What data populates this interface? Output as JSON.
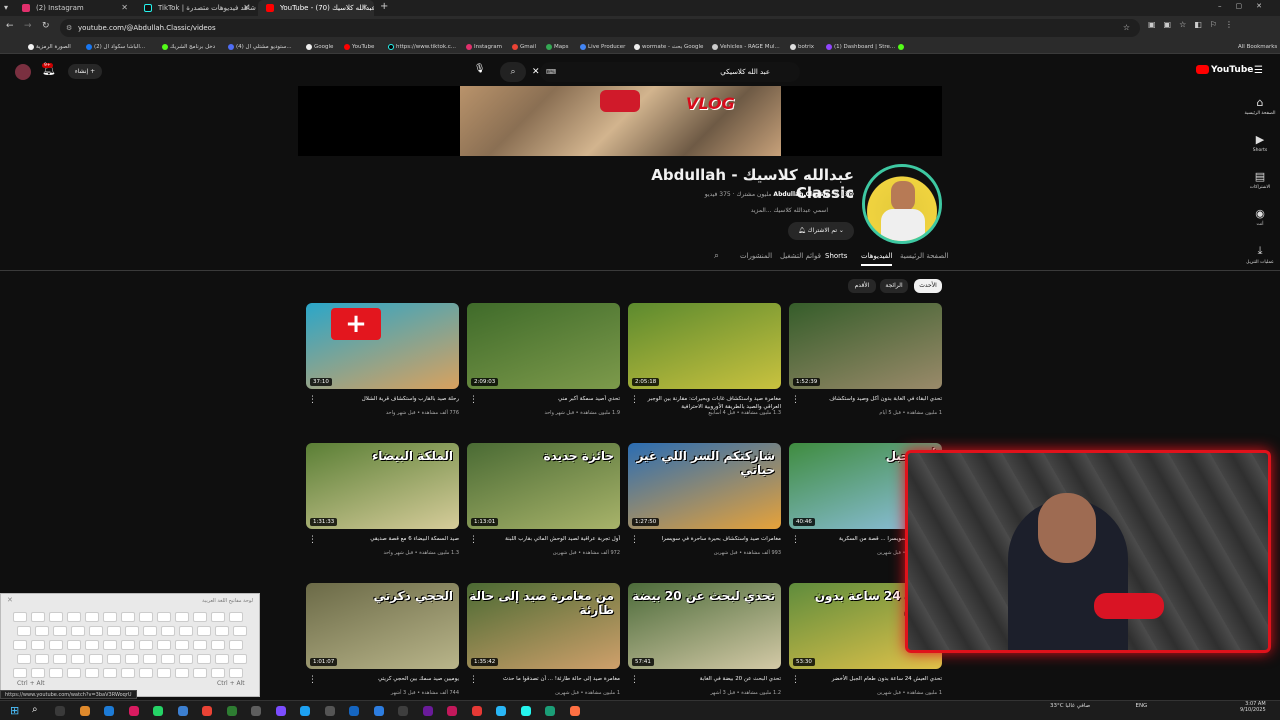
{
  "browser": {
    "tabs": [
      {
        "label": "(2) Instagram",
        "color": "#e1306c"
      },
      {
        "label": "TikTok | شاهد فيديوهات متصدرة",
        "color": "#000000"
      },
      {
        "label": "YouTube - عبدالله كلاسيك (70)",
        "color": "#ff0000"
      }
    ],
    "url": "youtube.com/@Abdullah.Classic/videos",
    "bookmarks": [
      "الصورة الرمزية",
      "(2) الباشا سكواد ال...",
      "دخل برنامج الشريك",
      "(4) ستوديو مشتلي ال...",
      "Google",
      "YouTube",
      "https://www.tiktok.c...",
      "Instagram",
      "Gmail",
      "Maps",
      "Live Producer",
      "wormate - بحث Google",
      "Vehicles - RAGE Mul...",
      "botrix",
      "(1) Dashboard | Stre..."
    ],
    "all_bookmarks": "All Bookmarks"
  },
  "youtube": {
    "logo": "YouTube",
    "create_label": "إنشاء",
    "notif_count": "9+",
    "search_value": "عبد الله كلاسيكي",
    "banner_text": "VLOG"
  },
  "channel": {
    "name": "عبدالله كلاسيك - Abdullah Classic",
    "handle": "@Abdullah.Classic",
    "subs": "2.13 مليون مشترك",
    "videos": "375 فيديو",
    "desc": "اسمي عبدالله كلاسيك ...المزيد",
    "subscribed_label": "تم الاشتراك",
    "tabs": [
      "الصفحة الرئيسية",
      "الفيديوهات",
      "Shorts",
      "قوائم التشغيل",
      "المنشورات"
    ],
    "chips": [
      "الأحدث",
      "الرائجة",
      "الأقدم"
    ]
  },
  "videos": [
    {
      "title": "رحلة صيد بالقارب واستكشاف قرية الشلال",
      "meta": "776 ألف مشاهدة • قبل شهر واحد",
      "dur": "37:10",
      "thumb_text": "",
      "c1": "#2aa6c9",
      "c2": "#d9a15e"
    },
    {
      "title": "تحدي أصيد سمكة أكبر مني",
      "meta": "1.9 مليون مشاهدة • قبل شهر واحد",
      "dur": "2:09:03",
      "thumb_text": "",
      "c1": "#3f6b2a",
      "c2": "#7d9a4b"
    },
    {
      "title": "مغامرة صيد واستكشاف غابات وبحيرات: مقارنة بين الوجبر العراقي والصيد بالطريقة الأوروبية الاحترافية",
      "meta": "1.3 مليون مشاهدة • قبل 4 أسابيع",
      "dur": "2:05:18",
      "thumb_text": "",
      "c1": "#5c8a2e",
      "c2": "#c9c23f"
    },
    {
      "title": "تحدي البقاء في الغابة بدون أكل وصيد واستكشاف",
      "meta": "1 مليون مشاهدة • قبل 5 أيام",
      "dur": "1:52:39",
      "thumb_text": "",
      "c1": "#355d2a",
      "c2": "#9a8a6a"
    },
    {
      "title": "صيد السمكة البيضاء 6 مع قصة صديقي",
      "meta": "1.3 مليون مشاهدة • قبل شهر واحد",
      "dur": "1:31:33",
      "thumb_text": "الملكة البيضاء",
      "c1": "#5a7f35",
      "c2": "#d6cc9a"
    },
    {
      "title": "أول تجربة عراقية لصيد الوحش المائي بقارب اللبنة",
      "meta": "972 ألف مشاهدة • قبل شهرين",
      "dur": "1:13:01",
      "thumb_text": "جائزة جديدة",
      "c1": "#4a6b34",
      "c2": "#a8b36a"
    },
    {
      "title": "مغامرات صيد واستكشاف بحيرة ساحرة في سويسرا",
      "meta": "993 ألف مشاهدة • قبل شهرين",
      "dur": "1:27:50",
      "thumb_text": "شاركتكم السر اللي غير حياتي",
      "c1": "#2b6db3",
      "c2": "#e6a23a"
    },
    {
      "title": "تحدي جبلي في سويسرا ... قصة من السكرية",
      "meta": "1 مليون مشاهدة • قبل شهرين",
      "dur": "40:46",
      "thumb_text": "أول جبل",
      "c1": "#3f8c3f",
      "c2": "#8ec0e0"
    },
    {
      "title": "يوميين صيد سمك بين الحجي كريتي",
      "meta": "744 ألف مشاهدة • قبل 3 أشهر",
      "dur": "1:01:07",
      "thumb_text": "الحجي دكرتي",
      "c1": "#6b6a47",
      "c2": "#b9b58a"
    },
    {
      "title": "مغامرة صيد إلى حالة طارئة! ... أن تصدقوا ما حدث",
      "meta": "1 مليون مشاهدة • قبل شهرين",
      "dur": "1:35:42",
      "thumb_text": "من مغامرة صيد إلى حالة طارئة",
      "c1": "#4b6a33",
      "c2": "#cfa06b"
    },
    {
      "title": "تحدي البحث عن 20 بيضة في الغابة",
      "meta": "1.2 مليون مشاهدة • قبل 3 أشهر",
      "dur": "57:41",
      "thumb_text": "تحدي لبحث عن 20 بيضة",
      "c1": "#4c6b3a",
      "c2": "#d3c9a6"
    },
    {
      "title": "تحدي العيش 24 ساعة بدون طعام الجبل الأخضر",
      "meta": "1 مليون مشاهدة • قبل شهرين",
      "dur": "53:30",
      "thumb_text": "تحدي 24 ساعة بدون طعام",
      "c1": "#5f8c3c",
      "c2": "#e0c24a"
    }
  ],
  "sidebar": [
    "الصفحة الرئيسية",
    "Shorts",
    "الاشتراكات",
    "أنت",
    "عمليات التنزيل"
  ],
  "keyboard": {
    "title": "لوحة مفاتيح اللغة العربية",
    "left_label": "Ctrl + Alt",
    "right_label": "Ctrl + Alt"
  },
  "status_url": "https://www.youtube.com/watch?v=3baV3RWoqrU",
  "tray": {
    "weather": "33°C صافي غالبا",
    "lang": "ENG",
    "time": "3:07 AM",
    "date": "9/10/2025"
  }
}
